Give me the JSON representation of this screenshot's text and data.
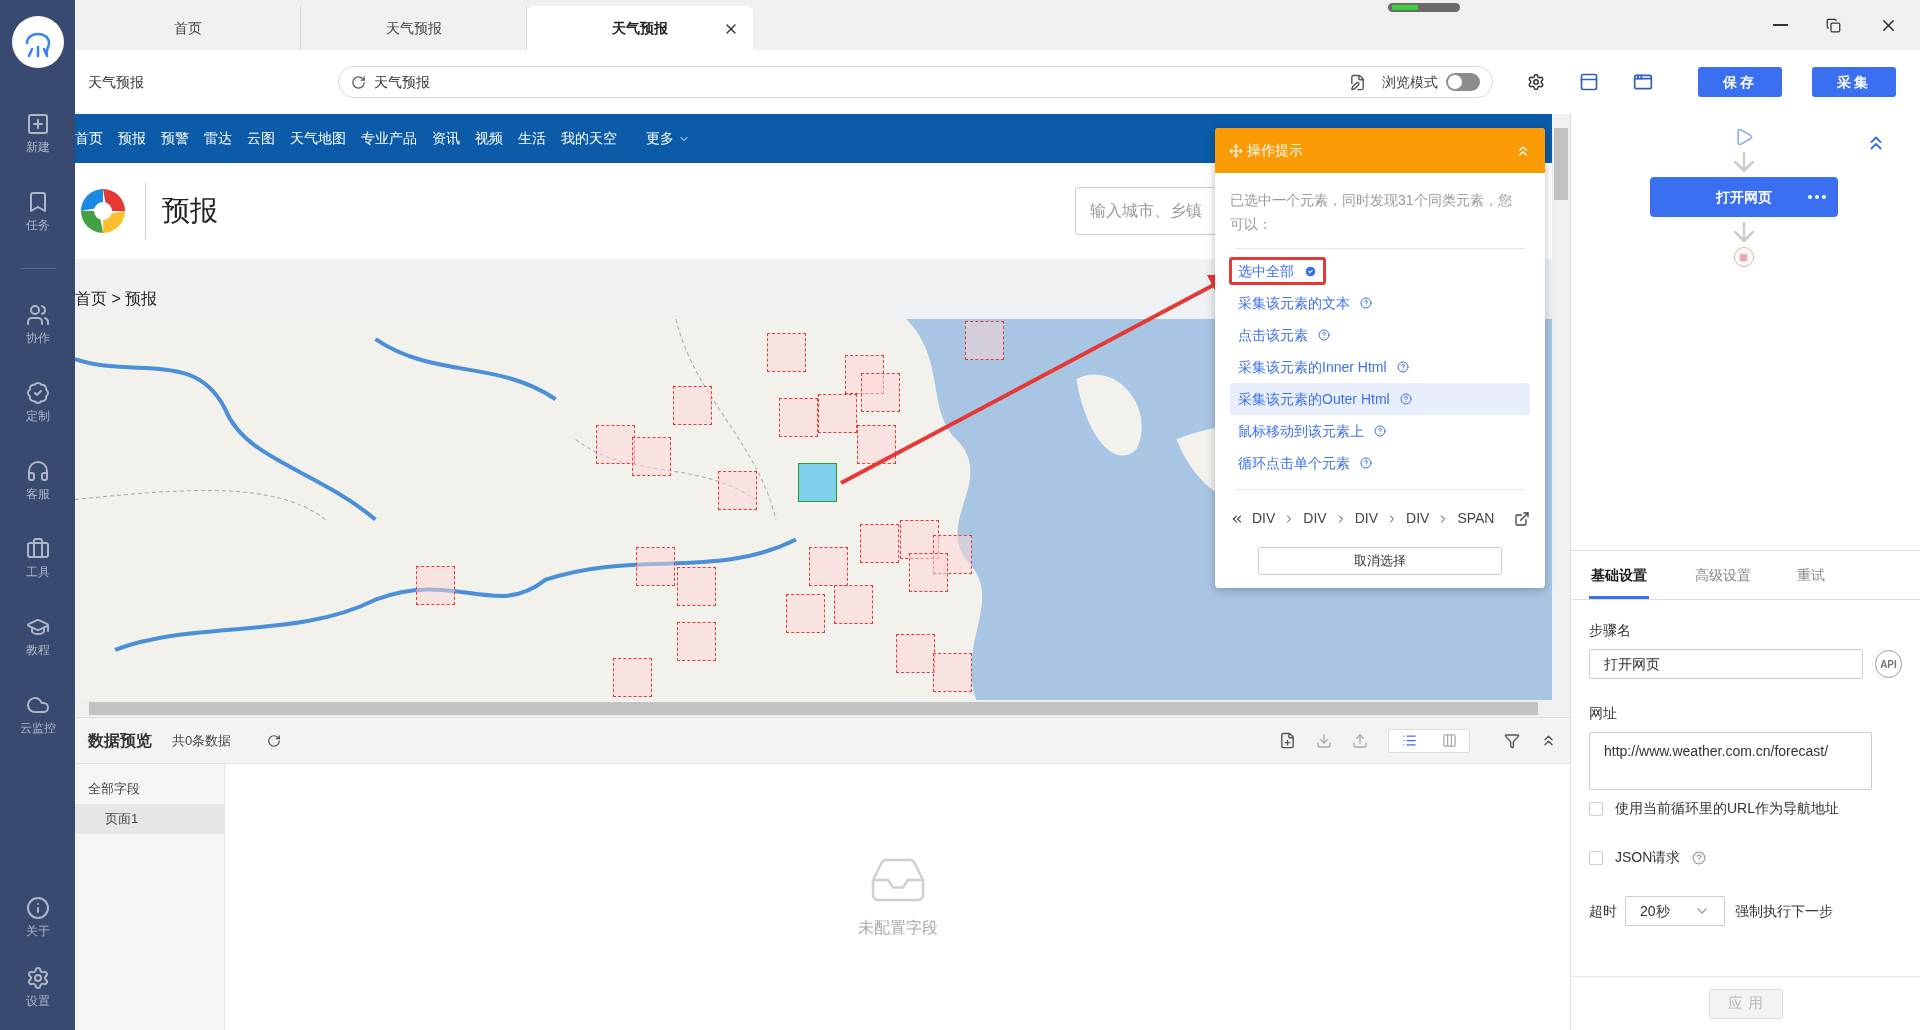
{
  "app_sidebar": {
    "items": [
      {
        "label": "新建"
      },
      {
        "label": "任务"
      },
      {
        "label": "协作"
      },
      {
        "label": "定制"
      },
      {
        "label": "客服"
      },
      {
        "label": "工具"
      },
      {
        "label": "教程"
      },
      {
        "label": "云监控"
      }
    ],
    "bottom_items": [
      {
        "label": "关于"
      },
      {
        "label": "设置"
      }
    ]
  },
  "tabs": [
    {
      "label": "首页",
      "selected": false,
      "closable": false
    },
    {
      "label": "天气预报",
      "selected": false,
      "closable": false
    },
    {
      "label": "天气预报",
      "selected": true,
      "closable": true
    }
  ],
  "address_bar": {
    "page_title": "天气预报",
    "url": "天气预报",
    "browse_mode_label": "浏览模式",
    "browse_mode_on": false
  },
  "action_buttons": [
    {
      "label": "保存"
    },
    {
      "label": "采集"
    }
  ],
  "web_page": {
    "nav": [
      "首页",
      "预报",
      "预警",
      "雷达",
      "云图",
      "天气地图",
      "专业产品",
      "资讯",
      "视频",
      "生活",
      "我的天空"
    ],
    "more": "更多",
    "logo_title": "预报",
    "search_placeholder": "输入城市、乡镇",
    "breadcrumb": "首页 > 预报"
  },
  "tip_popup": {
    "title": "操作提示",
    "expanded": true,
    "message": "已选中一个元素，同时发现31个同类元素，您可以：",
    "options": [
      {
        "label": "选中全部",
        "checked": true,
        "highlighted": false,
        "annotated": true
      },
      {
        "label": "采集该元素的文本",
        "checked": false,
        "highlighted": false,
        "annotated": false
      },
      {
        "label": "点击该元素",
        "checked": false,
        "highlighted": false,
        "annotated": false
      },
      {
        "label": "采集该元素的Inner Html",
        "checked": false,
        "highlighted": false,
        "annotated": false
      },
      {
        "label": "采集该元素的Outer Html",
        "checked": false,
        "highlighted": true,
        "annotated": false
      },
      {
        "label": "鼠标移动到该元素上",
        "checked": false,
        "highlighted": false,
        "annotated": false
      },
      {
        "label": "循环点击单个元素",
        "checked": false,
        "highlighted": false,
        "annotated": false
      }
    ],
    "path": [
      "DIV",
      "DIV",
      "DIV",
      "DIV",
      "SPAN"
    ],
    "cancel_label": "取消选择"
  },
  "data_preview": {
    "title": "数据预览",
    "count": "共0条数据",
    "views": [
      {
        "kind": "list",
        "selected": true
      },
      {
        "kind": "columns",
        "selected": false
      }
    ],
    "fields": {
      "label": "全部字段",
      "children": [
        {
          "label": "页面1",
          "selected": true
        }
      ]
    },
    "empty_text": "未配置字段"
  },
  "workflow": {
    "node": "打开网页"
  },
  "settings": {
    "tabs": [
      {
        "label": "基础设置",
        "selected": true
      },
      {
        "label": "高级设置",
        "selected": false
      },
      {
        "label": "重试",
        "selected": false
      }
    ],
    "step_name_label": "步骤名",
    "step_name": "打开网页",
    "api_badge": "API",
    "url_label": "网址",
    "url": "http://www.weather.com.cn/forecast/",
    "use_loop_url": {
      "label": "使用当前循环里的URL作为导航地址",
      "checked": false
    },
    "json_request": {
      "label": "JSON请求",
      "checked": false
    },
    "timeout_label": "超时",
    "timeout": "20秒",
    "force_next": "强制执行下一步",
    "apply": {
      "label": "应 用",
      "disabled": true
    }
  }
}
